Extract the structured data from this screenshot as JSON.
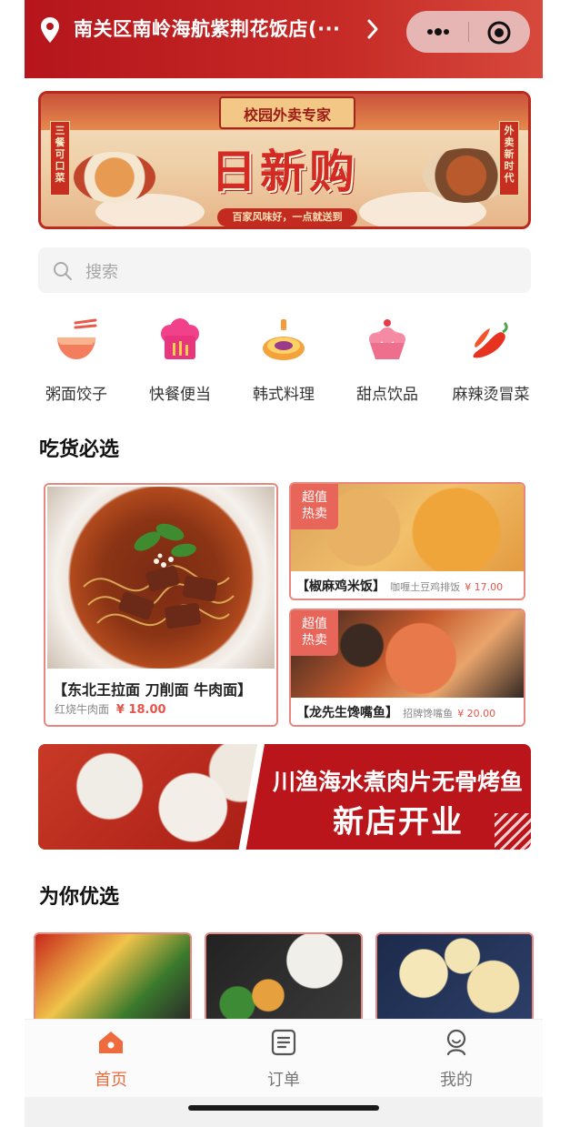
{
  "header": {
    "location": "南关区南岭海航紫荆花饭店(···"
  },
  "banner": {
    "plaque": "校园外卖专家",
    "title": "日新购",
    "subtitle": "百家风味好，一点就送到",
    "left_slogan": "三餐可口菜",
    "right_slogan": "外卖新时代"
  },
  "search": {
    "placeholder": "搜索"
  },
  "categories": [
    {
      "label": "粥面饺子",
      "icon": "noodle-bowl-icon"
    },
    {
      "label": "快餐便当",
      "icon": "chef-hat-icon"
    },
    {
      "label": "韩式料理",
      "icon": "bibimbap-icon"
    },
    {
      "label": "甜点饮品",
      "icon": "cupcake-icon"
    },
    {
      "label": "麻辣烫冒菜",
      "icon": "chili-pepper-icon"
    }
  ],
  "section_must": {
    "title": "吃货必选",
    "big": {
      "title": "【东北王拉面 刀削面 牛肉面】",
      "desc": "红烧牛肉面",
      "price": "¥ 18.00"
    },
    "small": [
      {
        "tag": "超值热卖",
        "title": "【椒麻鸡米饭】",
        "desc": "咖喱土豆鸡排饭",
        "price": "¥ 17.00"
      },
      {
        "tag": "超值热卖",
        "title": "【龙先生馋嘴鱼】",
        "desc": "招牌馋嘴鱼",
        "price": "¥ 20.00"
      }
    ]
  },
  "promo": {
    "line1": "川渔海水煮肉片无骨烤鱼",
    "line2": "新店开业"
  },
  "section_recommend": {
    "title": "为你优选"
  },
  "tabbar": [
    {
      "label": "首页",
      "icon": "home-icon",
      "active": true
    },
    {
      "label": "订单",
      "icon": "order-icon",
      "active": false
    },
    {
      "label": "我的",
      "icon": "profile-icon",
      "active": false
    }
  ],
  "colors": {
    "brand_red": "#b5151c",
    "accent_orange": "#ef6a3c",
    "price_red": "#e8534a"
  }
}
